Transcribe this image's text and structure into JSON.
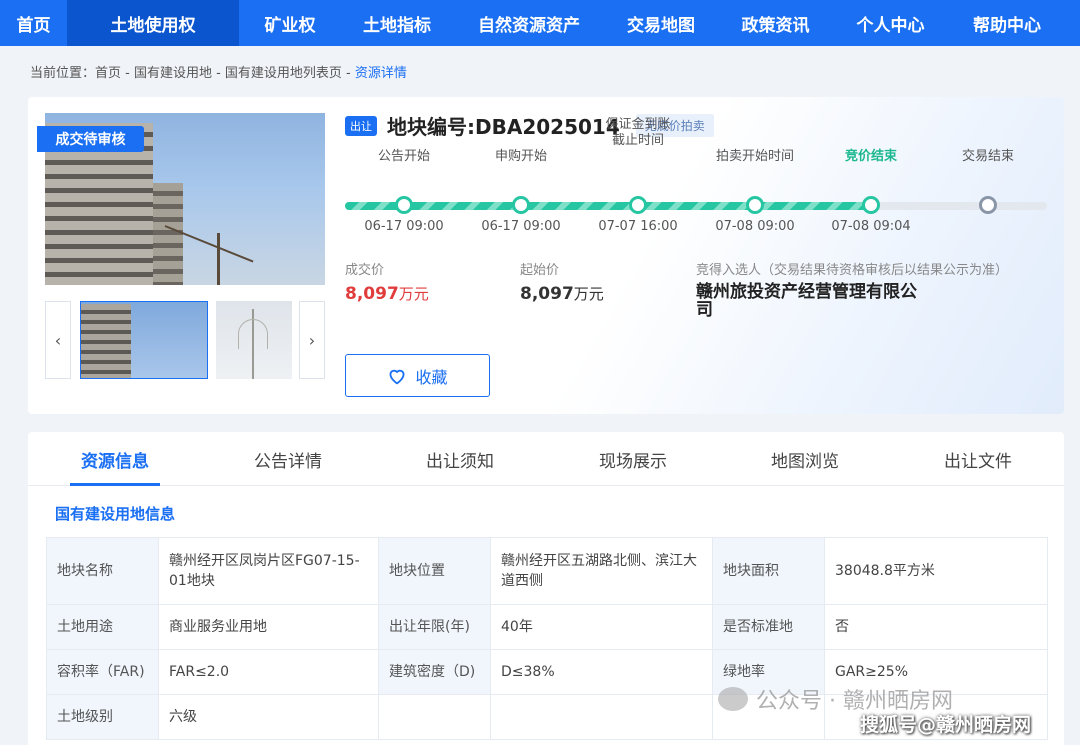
{
  "nav": {
    "items": [
      {
        "label": "首页"
      },
      {
        "label": "土地使用权"
      },
      {
        "label": "矿业权"
      },
      {
        "label": "土地指标"
      },
      {
        "label": "自然资源资产"
      },
      {
        "label": "交易地图"
      },
      {
        "label": "政策资讯"
      },
      {
        "label": "个人中心"
      },
      {
        "label": "帮助中心"
      }
    ],
    "active": "土地使用权"
  },
  "breadcrumb": {
    "prefix": "当前位置：",
    "path": "首页 - 国有建设用地 - 国有建设用地列表页 - ",
    "current": "资源详情"
  },
  "listing": {
    "status_tag": "成交待审核",
    "type_tag": "出让",
    "title": "地块编号:DBA2025014",
    "reserve_tag": "无底价拍卖",
    "timeline": [
      {
        "label": "公告开始",
        "date": "06-17 09:00",
        "state": "done"
      },
      {
        "label": "申购开始",
        "date": "06-17 09:00",
        "state": "done"
      },
      {
        "label": "保证金到账\n截止时间",
        "date": "07-07 16:00",
        "state": "done"
      },
      {
        "label": "拍卖开始时间",
        "date": "07-08 09:00",
        "state": "done"
      },
      {
        "label": "竞价结束",
        "date": "07-08 09:04",
        "state": "active"
      },
      {
        "label": "交易结束",
        "date": "",
        "state": "pending"
      }
    ],
    "deal_price": {
      "label": "成交价",
      "value": "8,097",
      "unit": "万元"
    },
    "start_price": {
      "label": "起始价",
      "value": "8,097",
      "unit": "万元"
    },
    "winner": {
      "label": "竞得入选人（交易结果待资格审核后以结果公示为准）",
      "value": "赣州旅投资产经营管理有限公司"
    },
    "fav_label": "收藏",
    "prev_arrow": "‹",
    "next_arrow": "›"
  },
  "tabs": [
    {
      "label": "资源信息"
    },
    {
      "label": "公告详情"
    },
    {
      "label": "出让须知"
    },
    {
      "label": "现场展示"
    },
    {
      "label": "地图浏览"
    },
    {
      "label": "出让文件"
    }
  ],
  "active_tab": "资源信息",
  "info": {
    "title": "国有建设用地信息",
    "rows": [
      [
        [
          "地块名称",
          "赣州经开区凤岗片区FG07-15-01地块"
        ],
        [
          "地块位置",
          "赣州经开区五湖路北侧、滨江大道西侧"
        ],
        [
          "地块面积",
          "38048.8平方米"
        ]
      ],
      [
        [
          "土地用途",
          "商业服务业用地"
        ],
        [
          "出让年限(年)",
          "40年"
        ],
        [
          "是否标准地",
          "否"
        ]
      ],
      [
        [
          "容积率（FAR)",
          "FAR≤2.0"
        ],
        [
          "建筑密度（D)",
          "D≤38%"
        ],
        [
          "绿地率",
          "GAR≥25%"
        ]
      ],
      [
        [
          "土地级别",
          "六级"
        ]
      ]
    ]
  },
  "watermark": {
    "text": "公众号 · 赣州晒房网",
    "source": "搜狐号@赣州晒房网"
  },
  "colors": {
    "primary": "#1a6ff2",
    "nav_active": "#0b56cf",
    "progress": "#27c6a3",
    "price": "#e03c3c",
    "panel_key_bg": "#f1f6fd"
  }
}
